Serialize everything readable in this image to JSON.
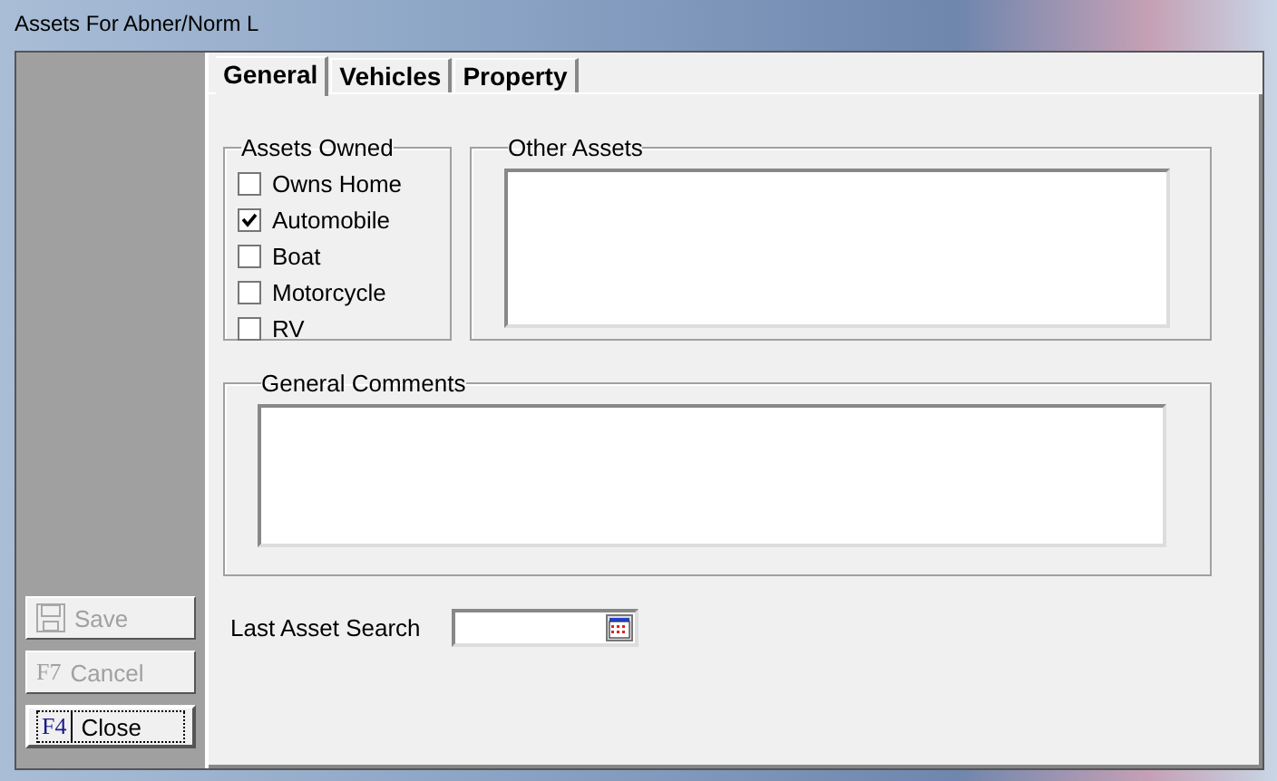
{
  "window": {
    "title": "Assets For Abner/Norm L"
  },
  "tabs": [
    {
      "label": "General",
      "selected": true
    },
    {
      "label": "Vehicles",
      "selected": false
    },
    {
      "label": "Property",
      "selected": false
    }
  ],
  "assets_owned": {
    "title": "Assets Owned",
    "items": [
      {
        "label": "Owns Home",
        "checked": false
      },
      {
        "label": "Automobile",
        "checked": true
      },
      {
        "label": "Boat",
        "checked": false
      },
      {
        "label": "Motorcycle",
        "checked": false
      },
      {
        "label": "RV",
        "checked": false
      }
    ]
  },
  "other_assets": {
    "title": "Other Assets"
  },
  "general_comments": {
    "title": "General Comments"
  },
  "last_asset_search": {
    "label": "Last Asset Search"
  },
  "buttons": [
    {
      "kind": "save",
      "label": "Save",
      "disabled": true,
      "focused": false
    },
    {
      "kind": "key",
      "key": "F7",
      "label": "Cancel",
      "disabled": true,
      "focused": false
    },
    {
      "kind": "key",
      "key": "F4",
      "label": "Close",
      "disabled": false,
      "focused": true
    }
  ]
}
